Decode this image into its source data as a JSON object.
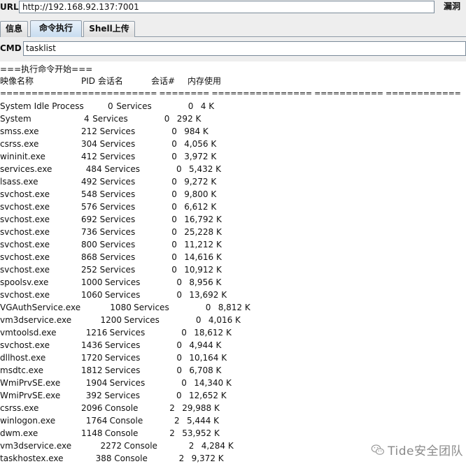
{
  "url_bar": {
    "label": "URL",
    "value": "http://192.168.92.137:7001",
    "scan_label": "漏洞"
  },
  "tabs": [
    {
      "label": "信息",
      "active": false
    },
    {
      "label": "命令执行",
      "active": true
    },
    {
      "label": "Shell上传",
      "active": false
    }
  ],
  "cmd": {
    "label": "CMD",
    "value": "tasklist"
  },
  "output": {
    "start_line": "===执行命令开始===",
    "headers": {
      "image": "映像名称",
      "pid_session": "PID 会话名",
      "session_num": "会话#",
      "mem": "内存使用"
    },
    "separator": "========================= ======== ================ =========== ============",
    "rows": [
      {
        "name": "System Idle Process",
        "pid": "0",
        "session": "Services",
        "num": "0",
        "mem": "4 K"
      },
      {
        "name": "System",
        "pid": "4",
        "session": "Services",
        "num": "0",
        "mem": "292 K"
      },
      {
        "name": "smss.exe",
        "pid": "212",
        "session": "Services",
        "num": "0",
        "mem": "984 K"
      },
      {
        "name": "csrss.exe",
        "pid": "304",
        "session": "Services",
        "num": "0",
        "mem": "4,056 K"
      },
      {
        "name": "wininit.exe",
        "pid": "412",
        "session": "Services",
        "num": "0",
        "mem": "3,972 K"
      },
      {
        "name": "services.exe",
        "pid": "484",
        "session": "Services",
        "num": "0",
        "mem": "5,432 K"
      },
      {
        "name": "lsass.exe",
        "pid": "492",
        "session": "Services",
        "num": "0",
        "mem": "9,272 K"
      },
      {
        "name": "svchost.exe",
        "pid": "548",
        "session": "Services",
        "num": "0",
        "mem": "9,800 K"
      },
      {
        "name": "svchost.exe",
        "pid": "576",
        "session": "Services",
        "num": "0",
        "mem": "6,612 K"
      },
      {
        "name": "svchost.exe",
        "pid": "692",
        "session": "Services",
        "num": "0",
        "mem": "16,792 K"
      },
      {
        "name": "svchost.exe",
        "pid": "736",
        "session": "Services",
        "num": "0",
        "mem": "25,228 K"
      },
      {
        "name": "svchost.exe",
        "pid": "800",
        "session": "Services",
        "num": "0",
        "mem": "11,212 K"
      },
      {
        "name": "svchost.exe",
        "pid": "868",
        "session": "Services",
        "num": "0",
        "mem": "14,616 K"
      },
      {
        "name": "svchost.exe",
        "pid": "252",
        "session": "Services",
        "num": "0",
        "mem": "10,912 K"
      },
      {
        "name": "spoolsv.exe",
        "pid": "1000",
        "session": "Services",
        "num": "0",
        "mem": "8,956 K"
      },
      {
        "name": "svchost.exe",
        "pid": "1060",
        "session": "Services",
        "num": "0",
        "mem": "13,692 K"
      },
      {
        "name": "VGAuthService.exe",
        "pid": "1080",
        "session": "Services",
        "num": "0",
        "mem": "8,812 K"
      },
      {
        "name": "vm3dservice.exe",
        "pid": "1200",
        "session": "Services",
        "num": "0",
        "mem": "4,016 K"
      },
      {
        "name": "vmtoolsd.exe",
        "pid": "1216",
        "session": "Services",
        "num": "0",
        "mem": "18,612 K"
      },
      {
        "name": "svchost.exe",
        "pid": "1436",
        "session": "Services",
        "num": "0",
        "mem": "4,944 K"
      },
      {
        "name": "dllhost.exe",
        "pid": "1720",
        "session": "Services",
        "num": "0",
        "mem": "10,164 K"
      },
      {
        "name": "msdtc.exe",
        "pid": "1812",
        "session": "Services",
        "num": "0",
        "mem": "6,708 K"
      },
      {
        "name": "WmiPrvSE.exe",
        "pid": "1904",
        "session": "Services",
        "num": "0",
        "mem": "14,340 K"
      },
      {
        "name": "WmiPrvSE.exe",
        "pid": "392",
        "session": "Services",
        "num": "0",
        "mem": "12,652 K"
      },
      {
        "name": "csrss.exe",
        "pid": "2096",
        "session": "Console",
        "num": "2",
        "mem": "29,988 K"
      },
      {
        "name": "winlogon.exe",
        "pid": "1764",
        "session": "Console",
        "num": "2",
        "mem": "5,444 K"
      },
      {
        "name": "dwm.exe",
        "pid": "1148",
        "session": "Console",
        "num": "2",
        "mem": "53,952 K"
      },
      {
        "name": "vm3dservice.exe",
        "pid": "2272",
        "session": "Console",
        "num": "2",
        "mem": "4,284 K"
      },
      {
        "name": "taskhostex.exe",
        "pid": "388",
        "session": "Console",
        "num": "2",
        "mem": "9,372 K"
      }
    ]
  },
  "watermark": {
    "text": "Tide安全团队",
    "icon": "wechat-icon"
  }
}
